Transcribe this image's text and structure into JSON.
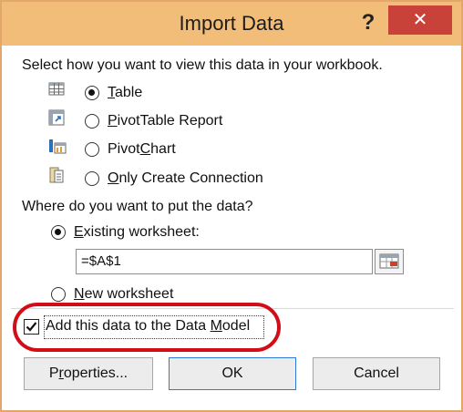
{
  "titlebar": {
    "title": "Import Data",
    "help_label": "?",
    "close_label": "✕"
  },
  "view_section": {
    "prompt": "Select how you want to view this data in your workbook.",
    "options": [
      {
        "first": "T",
        "rest": "able",
        "icon": "table-icon",
        "selected": true
      },
      {
        "first": "P",
        "rest": "ivotTable Report",
        "icon": "pivottable-icon",
        "selected": false
      },
      {
        "first": "Pivot",
        "mid": "C",
        "rest": "hart",
        "icon": "pivotchart-icon",
        "selected": false
      },
      {
        "first": "O",
        "rest": "nly Create Connection",
        "icon": "connection-icon",
        "selected": false
      }
    ]
  },
  "location_section": {
    "prompt": "Where do you want to put the data?",
    "existing": {
      "first": "E",
      "rest": "xisting worksheet:",
      "selected": true
    },
    "range_value": "=$A$1",
    "new": {
      "first": "N",
      "rest": "ew worksheet",
      "selected": false
    }
  },
  "data_model": {
    "label_a": "Add this data to the Data ",
    "label_u": "M",
    "label_b": "odel",
    "checked": true
  },
  "buttons": {
    "properties_a": "P",
    "properties_u": "r",
    "properties_b": "operties...",
    "ok": "OK",
    "cancel": "Cancel"
  },
  "colors": {
    "title_bar": "#f1bd79",
    "close_button": "#c9423a",
    "highlight_circle": "#d20d18",
    "ok_border": "#2f7ad7"
  }
}
